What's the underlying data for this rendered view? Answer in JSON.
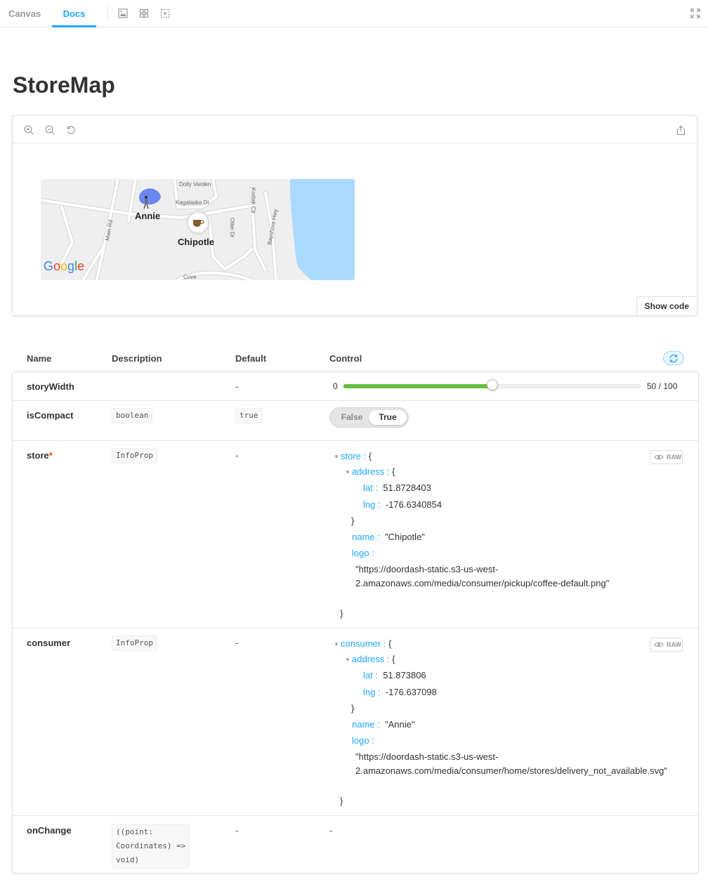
{
  "toolbar": {
    "tabs": [
      {
        "label": "Canvas",
        "active": false
      },
      {
        "label": "Docs",
        "active": true
      }
    ],
    "icons": [
      "image-icon",
      "grid-icon",
      "outline-icon"
    ],
    "fullscreen_icon": "fullscreen-icon"
  },
  "page": {
    "title": "StoreMap"
  },
  "preview": {
    "zoom_icons": [
      "zoom-in-icon",
      "zoom-out-icon",
      "zoom-reset-icon"
    ],
    "share_icon": "share-icon",
    "show_code_label": "Show code",
    "map": {
      "streets": [
        "Dolly Varden",
        "Kagalaska Dr",
        "Kodiak Cir",
        "Main Rd",
        "Otter Dr",
        "Bayshore Hwy",
        "Cove"
      ],
      "markers": [
        {
          "label": "Annie",
          "icon": "person-icon"
        },
        {
          "label": "Chipotle",
          "icon": "coffee-icon"
        }
      ],
      "logo": "Google",
      "water_color": "#aadaff"
    }
  },
  "props_table": {
    "headers": {
      "name": "Name",
      "description": "Description",
      "default": "Default",
      "control": "Control"
    },
    "reset_icon": "reset-icon",
    "rows": {
      "storyWidth": {
        "name": "storyWidth",
        "default": "-",
        "control": {
          "min": "0",
          "value": 50,
          "max": 100,
          "value_text": "50 / 100"
        }
      },
      "isCompact": {
        "name": "isCompact",
        "type": "boolean",
        "default": "true",
        "control": {
          "off_label": "False",
          "on_label": "True",
          "selected": "True"
        }
      },
      "store": {
        "name": "store",
        "required_mark": "*",
        "type": "InfoProp",
        "default": "-",
        "raw_label": "RAW",
        "tree": {
          "root_key": "store :",
          "open": "{",
          "address_key": "address :",
          "address_open": "{",
          "lat_key": "lat :",
          "lat_value": "51.8728403",
          "lng_key": "lng :",
          "lng_value": "-176.6340854",
          "address_close": "}",
          "name_key": "name :",
          "name_value": "\"Chipotle\"",
          "logo_key": "logo :",
          "logo_value_1": "\"https://doordash-static.s3-us-west-",
          "logo_value_2": "2.amazonaws.com/media/consumer/pickup/coffee-default.png\"",
          "close": "}"
        }
      },
      "consumer": {
        "name": "consumer",
        "type": "InfoProp",
        "default": "-",
        "raw_label": "RAW",
        "tree": {
          "root_key": "consumer :",
          "open": "{",
          "address_key": "address :",
          "address_open": "{",
          "lat_key": "lat :",
          "lat_value": "51.873806",
          "lng_key": "lng :",
          "lng_value": "-176.637098",
          "address_close": "}",
          "name_key": "name :",
          "name_value": "\"Annie\"",
          "logo_key": "logo :",
          "logo_value_1": "\"https://doordash-static.s3-us-west-",
          "logo_value_2": "2.amazonaws.com/media/consumer/home/stores/delivery_not_available.svg\"",
          "close": "}"
        }
      },
      "onChange": {
        "name": "onChange",
        "type_lines": [
          "((point:",
          "Coordinates) =>",
          "void)"
        ],
        "default": "-",
        "control": "-"
      }
    }
  },
  "colors": {
    "accent": "#1ea7fd",
    "slider_fill": "#66bf3c",
    "required": "#ff4400"
  }
}
